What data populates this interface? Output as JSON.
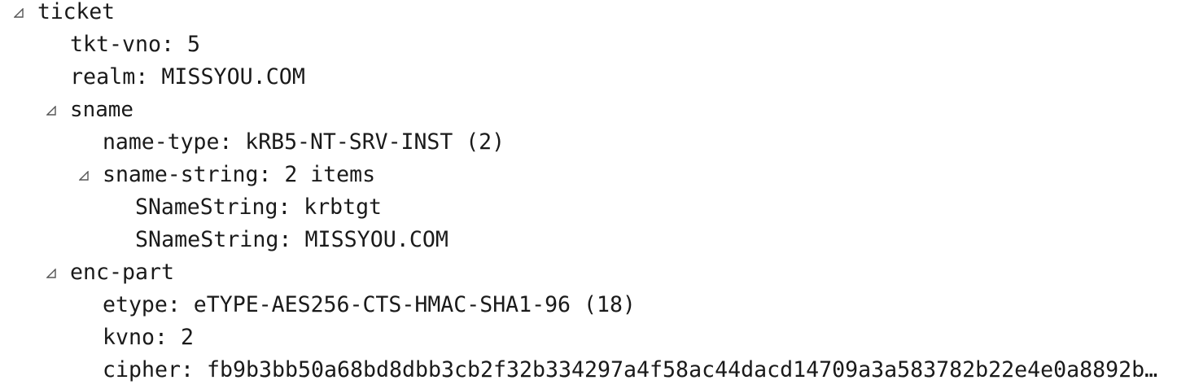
{
  "tree": {
    "ticket": {
      "label": "ticket",
      "expanded": true,
      "expand_icon": "expanded-triangle-icon"
    },
    "tkt_vno": {
      "label": "tkt-vno: 5"
    },
    "realm": {
      "label": "realm: MISSYOU.COM"
    },
    "sname": {
      "label": "sname",
      "expanded": true,
      "expand_icon": "expanded-triangle-icon"
    },
    "name_type": {
      "label": "name-type: kRB5-NT-SRV-INST (2)"
    },
    "sname_string": {
      "label": "sname-string: 2 items",
      "expanded": true,
      "expand_icon": "expanded-triangle-icon"
    },
    "sname_string_items": [
      {
        "label": "SNameString: krbtgt"
      },
      {
        "label": "SNameString: MISSYOU.COM"
      }
    ],
    "enc_part": {
      "label": "enc-part",
      "expanded": true,
      "expand_icon": "expanded-triangle-icon"
    },
    "etype": {
      "label": "etype: eTYPE-AES256-CTS-HMAC-SHA1-96 (18)"
    },
    "kvno": {
      "label": "kvno: 2"
    },
    "cipher": {
      "label": "cipher: fb9b3bb50a68bd8dbb3cb2f32b334297a4f58ac44dacd14709a3a583782b22e4e0a8892b…"
    }
  },
  "colors": {
    "text": "#1a1a1a",
    "toggle": "#555555",
    "background": "#ffffff"
  }
}
